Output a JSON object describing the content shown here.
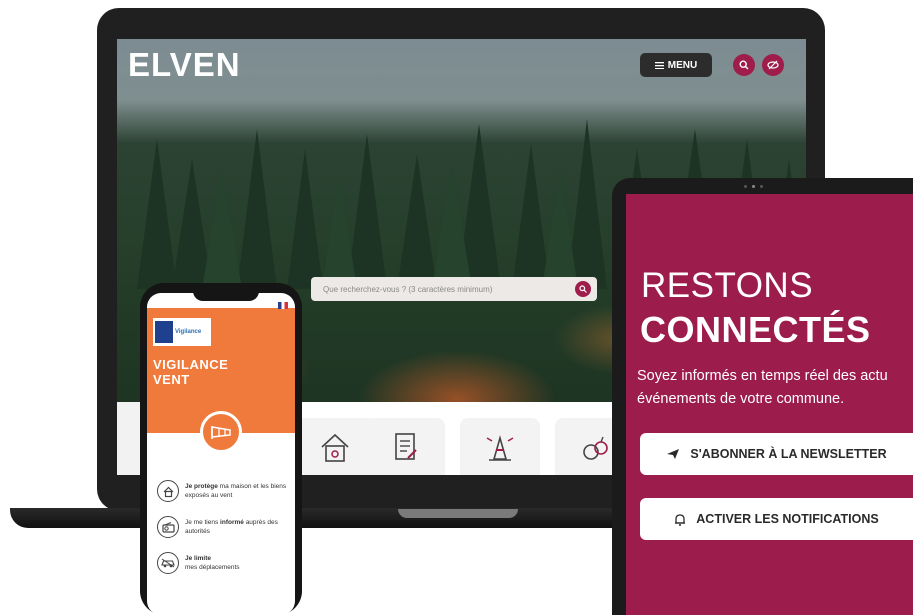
{
  "laptop": {
    "site_logo": "ELVEN",
    "menu_label": "MENU",
    "search_placeholder": "Que recherchez-vous ? (3 caractères minimum)",
    "quick_access_icons": [
      "house-icon",
      "document-icon",
      "traffic-cone-icon",
      "apple-basket-icon"
    ],
    "accent_color": "#9f1d4b"
  },
  "phone": {
    "badge_text": "Vigilance",
    "alert_title_line1": "VIGILANCE",
    "alert_title_line2": "VENT",
    "hero_color": "#f07a3b",
    "tips": [
      {
        "bold": "Je protège",
        "rest": " ma maison et les biens exposés au vent",
        "icon": "house-hand-icon"
      },
      {
        "pre": "Je me tiens ",
        "bold": "informé",
        "rest": " auprès des autorités",
        "icon": "radio-icon"
      },
      {
        "bold": "Je limite",
        "rest": " mes déplacements",
        "icon": "car-icon"
      }
    ]
  },
  "tablet": {
    "headline_light": "RESTONS",
    "headline_bold": "CONNECTÉS",
    "description_line1": "Soyez informés en temps réel des actu",
    "description_line2": "événements de votre commune.",
    "newsletter_button": "S'ABONNER À LA NEWSLETTER",
    "notifications_button": "ACTIVER LES NOTIFICATIONS",
    "background_color": "#9c1d4b"
  }
}
